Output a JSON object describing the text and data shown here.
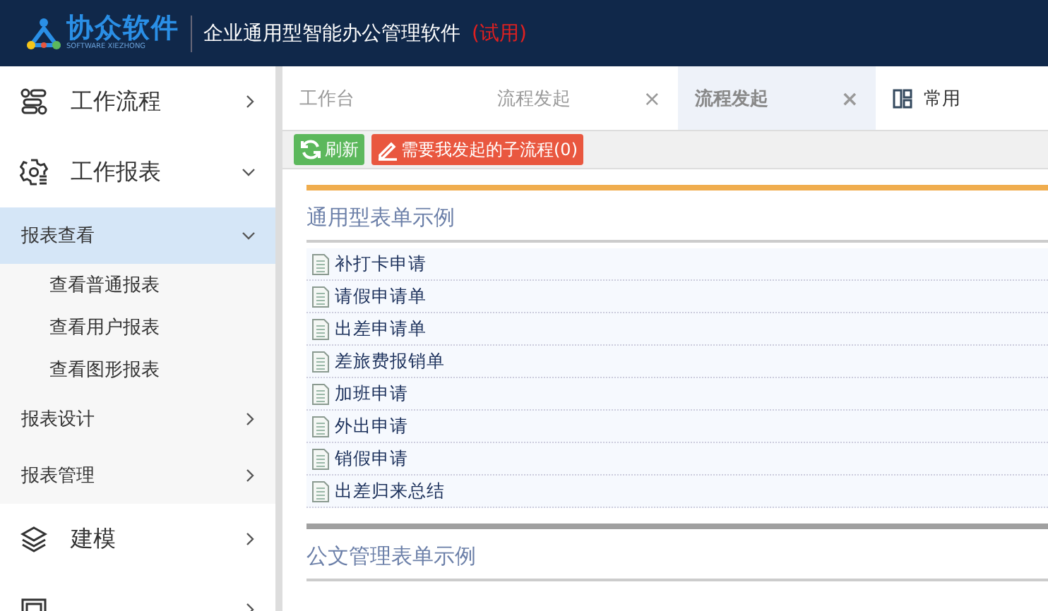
{
  "header": {
    "logo_text": "协众软件",
    "logo_subtext": "SOFTWARE XIEZHONG",
    "title": "企业通用型智能办公管理软件",
    "title_badge": "(试用)"
  },
  "sidebar": {
    "items": [
      {
        "label": "工作流程",
        "expanded": false
      },
      {
        "label": "工作报表",
        "expanded": true,
        "children": [
          {
            "label": "报表查看",
            "expanded": true,
            "selected": true,
            "children": [
              {
                "label": "查看普通报表"
              },
              {
                "label": "查看用户报表"
              },
              {
                "label": "查看图形报表"
              }
            ]
          },
          {
            "label": "报表设计",
            "expanded": false,
            "selected": false
          },
          {
            "label": "报表管理",
            "expanded": false,
            "selected": false
          }
        ]
      },
      {
        "label": "建模",
        "expanded": false
      },
      {
        "expanded": false
      }
    ]
  },
  "tabs": [
    {
      "label": "工作台",
      "selected": false
    },
    {
      "label": "流程发起",
      "selected": false,
      "close": "×"
    },
    {
      "label": "流程发起",
      "selected": true,
      "close": "×"
    }
  ],
  "favorites": {
    "label": "常用"
  },
  "toolbar": [
    {
      "kind": "refresh",
      "label": "刷新"
    },
    {
      "kind": "edit",
      "label": "需要我发起的子流程(0)"
    }
  ],
  "sections": [
    {
      "title": "通用型表单示例",
      "items": [
        "补打卡申请",
        "请假申请单",
        "出差申请单",
        "差旅费报销单",
        "加班申请",
        "外出申请",
        "销假申请",
        "出差归来总结"
      ]
    },
    {
      "title": "公文管理表单示例"
    }
  ]
}
